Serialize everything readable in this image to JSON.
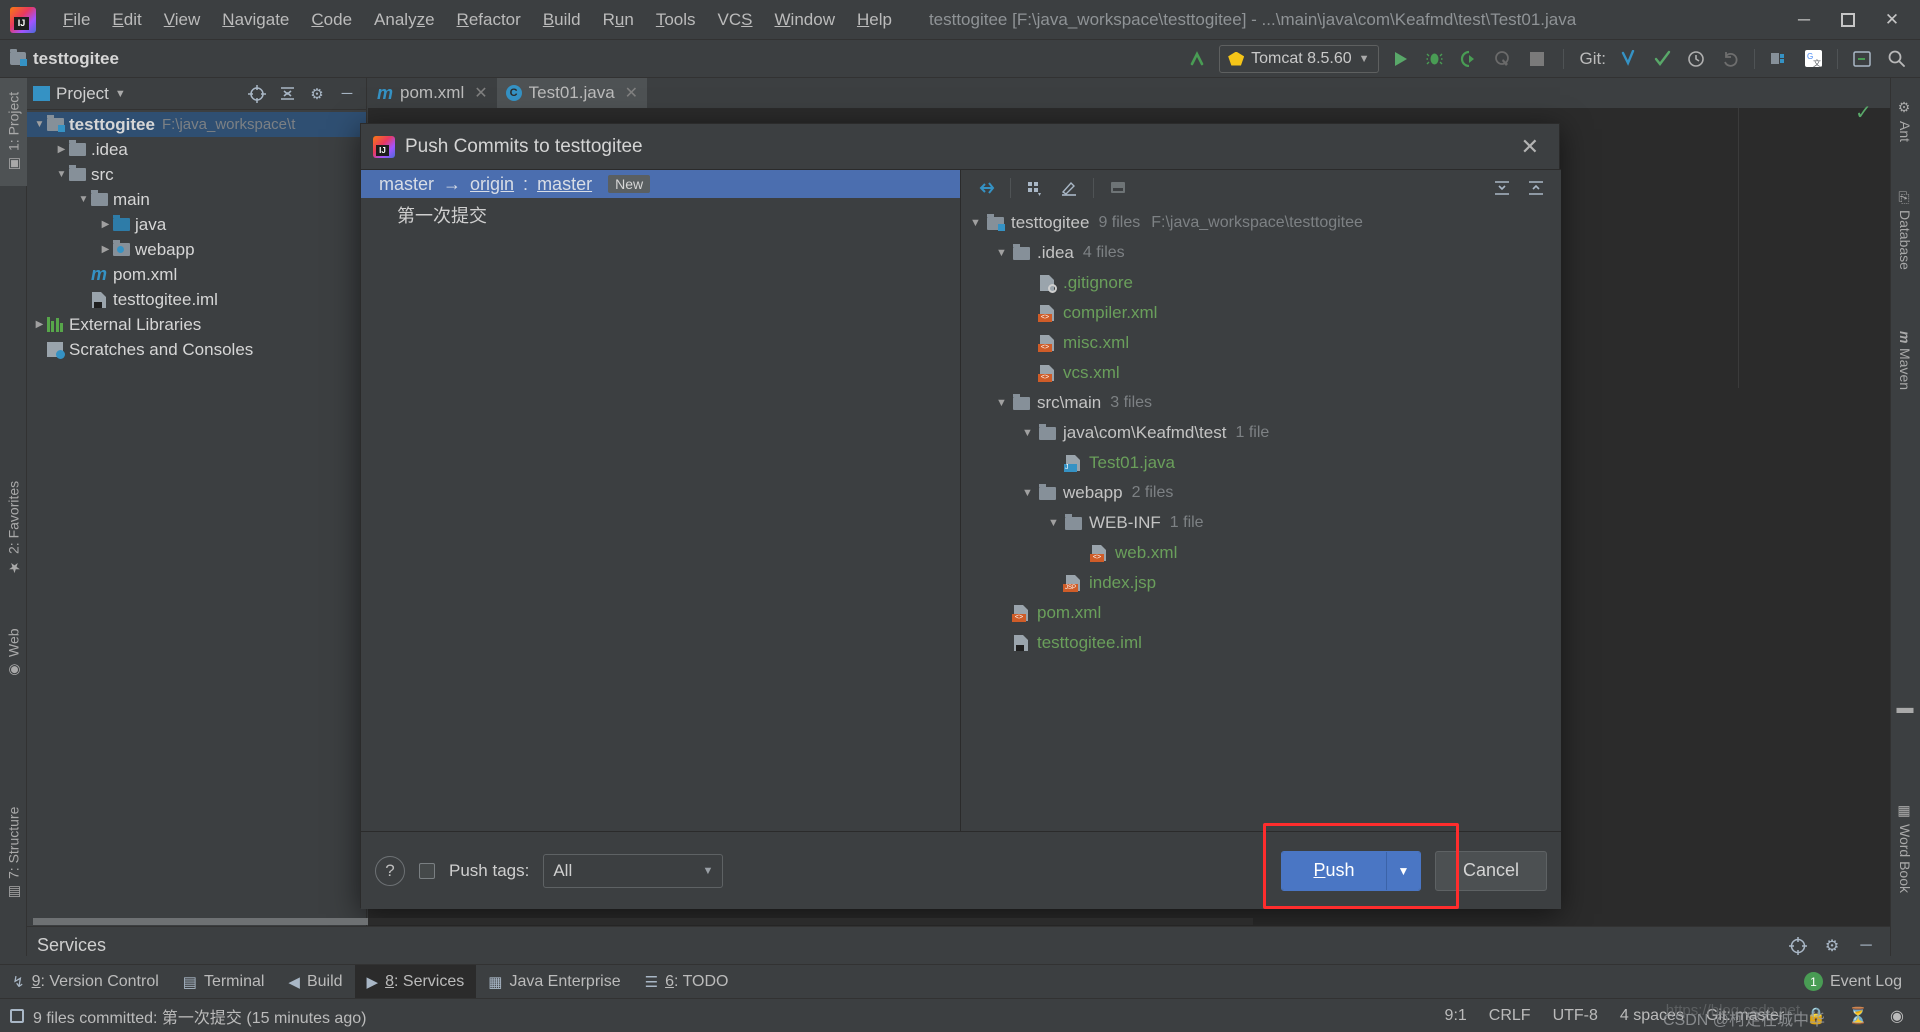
{
  "titlebar": {
    "menus": [
      "File",
      "Edit",
      "View",
      "Navigate",
      "Code",
      "Analyze",
      "Refactor",
      "Build",
      "Run",
      "Tools",
      "VCS",
      "Window",
      "Help"
    ],
    "window_title": "testtogitee [F:\\java_workspace\\testtogitee] - ...\\main\\java\\com\\Keafmd\\test\\Test01.java",
    "minimize": "─",
    "maximize": "☐",
    "close": "✕"
  },
  "toolbar": {
    "breadcrumb": "testtogitee",
    "run_config": "Tomcat 8.5.60",
    "git_label": "Git:",
    "icons": [
      "build-icon",
      "run-icon",
      "debug-icon",
      "run-coverage-icon",
      "profile-icon",
      "stop-icon",
      "update-project-icon",
      "commit-icon",
      "history-icon",
      "rollback-icon",
      "project-structure-icon",
      "translate-icon",
      "terminal-icon",
      "search-everywhere-icon"
    ]
  },
  "left_strip": {
    "tabs": [
      {
        "label": "1: Project",
        "icon": "project-icon",
        "selected": true
      },
      {
        "label": "2: Favorites",
        "icon": "star-icon",
        "selected": false
      },
      {
        "label": "Web",
        "icon": "web-icon",
        "selected": false
      },
      {
        "label": "7: Structure",
        "icon": "structure-icon",
        "selected": false
      }
    ]
  },
  "right_strip": {
    "tabs": [
      {
        "label": "Ant",
        "icon": "ant-icon"
      },
      {
        "label": "Database",
        "icon": "database-icon"
      },
      {
        "label": "Maven",
        "icon": "maven-icon"
      },
      {
        "label": "Word Book",
        "icon": "word-book-icon"
      }
    ]
  },
  "project_panel": {
    "title": "Project",
    "tree": [
      {
        "indent": 0,
        "arrow": "▼",
        "icon": "module-folder-icon",
        "name": "testtogitee",
        "path": "F:\\java_workspace\\t",
        "bold": true,
        "selected": true
      },
      {
        "indent": 1,
        "arrow": "▶",
        "icon": "folder-icon",
        "name": ".idea",
        "path": "",
        "bold": false,
        "selected": false
      },
      {
        "indent": 1,
        "arrow": "▼",
        "icon": "folder-icon",
        "name": "src",
        "path": "",
        "bold": false,
        "selected": false
      },
      {
        "indent": 2,
        "arrow": "▼",
        "icon": "folder-icon",
        "name": "main",
        "path": "",
        "bold": false,
        "selected": false
      },
      {
        "indent": 3,
        "arrow": "▶",
        "icon": "source-folder-icon",
        "name": "java",
        "path": "",
        "bold": false,
        "selected": false
      },
      {
        "indent": 3,
        "arrow": "▶",
        "icon": "web-folder-icon",
        "name": "webapp",
        "path": "",
        "bold": false,
        "selected": false
      },
      {
        "indent": 2,
        "arrow": "",
        "icon": "maven-file-icon",
        "name": "pom.xml",
        "path": "",
        "bold": false,
        "selected": false
      },
      {
        "indent": 2,
        "arrow": "",
        "icon": "iml-file-icon",
        "name": "testtogitee.iml",
        "path": "",
        "bold": false,
        "selected": false
      },
      {
        "indent": 0,
        "arrow": "▶",
        "icon": "libraries-icon",
        "name": "External Libraries",
        "path": "",
        "bold": false,
        "selected": false
      },
      {
        "indent": 0,
        "arrow": "",
        "icon": "scratches-icon",
        "name": "Scratches and Consoles",
        "path": "",
        "bold": false,
        "selected": false
      }
    ]
  },
  "editor_tabs": [
    {
      "label": "pom.xml",
      "icon": "maven-file-icon",
      "active": false,
      "close": "✕"
    },
    {
      "label": "Test01.java",
      "icon": "java-class-icon",
      "active": true,
      "close": "✕"
    }
  ],
  "dialog": {
    "title": "Push Commits to testtogitee",
    "close": "✕",
    "commit_row": {
      "local_branch": "master",
      "arrow": "→",
      "remote": "origin",
      "separator": ":",
      "remote_branch": "master",
      "badge": "New"
    },
    "commit_message": "第一次提交",
    "files_toolbar": [
      "collapse-all-icon",
      "group-by-icon",
      "edit-icon",
      "preview-icon",
      "expand-all-icon",
      "collapse-icon"
    ],
    "file_tree": [
      {
        "indent": 0,
        "arrow": "▼",
        "icon": "module-folder-icon",
        "name": "testtogitee",
        "count": "9 files",
        "path": "F:\\java_workspace\\testtogitee",
        "kind": "dir"
      },
      {
        "indent": 1,
        "arrow": "▼",
        "icon": "folder-icon",
        "name": ".idea",
        "count": "4 files",
        "path": "",
        "kind": "dir"
      },
      {
        "indent": 2,
        "arrow": "",
        "icon": "gitignore-file-icon",
        "name": ".gitignore",
        "count": "",
        "path": "",
        "kind": "file"
      },
      {
        "indent": 2,
        "arrow": "",
        "icon": "xml-file-icon",
        "name": "compiler.xml",
        "count": "",
        "path": "",
        "kind": "file"
      },
      {
        "indent": 2,
        "arrow": "",
        "icon": "xml-file-icon",
        "name": "misc.xml",
        "count": "",
        "path": "",
        "kind": "file"
      },
      {
        "indent": 2,
        "arrow": "",
        "icon": "xml-file-icon",
        "name": "vcs.xml",
        "count": "",
        "path": "",
        "kind": "file"
      },
      {
        "indent": 1,
        "arrow": "▼",
        "icon": "folder-icon",
        "name": "src\\main",
        "count": "3 files",
        "path": "",
        "kind": "dir"
      },
      {
        "indent": 2,
        "arrow": "▼",
        "icon": "folder-icon",
        "name": "java\\com\\Keafmd\\test",
        "count": "1 file",
        "path": "",
        "kind": "dir"
      },
      {
        "indent": 3,
        "arrow": "",
        "icon": "java-file-icon",
        "name": "Test01.java",
        "count": "",
        "path": "",
        "kind": "file"
      },
      {
        "indent": 2,
        "arrow": "▼",
        "icon": "folder-icon",
        "name": "webapp",
        "count": "2 files",
        "path": "",
        "kind": "dir"
      },
      {
        "indent": 3,
        "arrow": "▼",
        "icon": "folder-icon",
        "name": "WEB-INF",
        "count": "1 file",
        "path": "",
        "kind": "dir"
      },
      {
        "indent": 4,
        "arrow": "",
        "icon": "xml-file-icon",
        "name": "web.xml",
        "count": "",
        "path": "",
        "kind": "file"
      },
      {
        "indent": 3,
        "arrow": "",
        "icon": "jsp-file-icon",
        "name": "index.jsp",
        "count": "",
        "path": "",
        "kind": "file"
      },
      {
        "indent": 1,
        "arrow": "",
        "icon": "xml-file-icon",
        "name": "pom.xml",
        "count": "",
        "path": "",
        "kind": "file"
      },
      {
        "indent": 1,
        "arrow": "",
        "icon": "iml-file-icon",
        "name": "testtogitee.iml",
        "count": "",
        "path": "",
        "kind": "file"
      }
    ],
    "footer": {
      "help": "?",
      "push_tags_label": "Push tags:",
      "push_tags_value": "All",
      "push_tags_checked": false,
      "push_button": "Push",
      "push_dropdown": "▼",
      "cancel_button": "Cancel",
      "highlight_color": "#ff2d2d"
    }
  },
  "services_panel": {
    "title": "Services",
    "icons": [
      "settings-target-icon",
      "gear-icon",
      "minimize-icon"
    ]
  },
  "bottom_tabs": [
    {
      "label": "9: Version Control",
      "icon": "version-control-icon",
      "active": false
    },
    {
      "label": "Terminal",
      "icon": "terminal-icon",
      "active": false
    },
    {
      "label": "Build",
      "icon": "build-icon",
      "active": false
    },
    {
      "label": "8: Services",
      "icon": "services-icon",
      "active": true
    },
    {
      "label": "Java Enterprise",
      "icon": "java-enterprise-icon",
      "active": false
    },
    {
      "label": "6: TODO",
      "icon": "todo-icon",
      "active": false
    }
  ],
  "event_log": {
    "count": "1",
    "label": "Event Log"
  },
  "statusbar": {
    "message": "9 files committed: 第一次提交 (15 minutes ago)",
    "caret": "9:1",
    "line_separator": "CRLF",
    "encoding": "UTF-8",
    "indent": "4 spaces",
    "branch": "Git: master",
    "watermark": "https://blog.csdn.net",
    "watermark2": "CSDN @柯足在城中华"
  },
  "colors": {
    "background": "#3c3f41",
    "editor_bg": "#2b2b2b",
    "accent_blue": "#4b6eaf",
    "selection": "#2f4f72",
    "file_green": "#6a9f5b",
    "highlight_red": "#ff2d2d"
  }
}
